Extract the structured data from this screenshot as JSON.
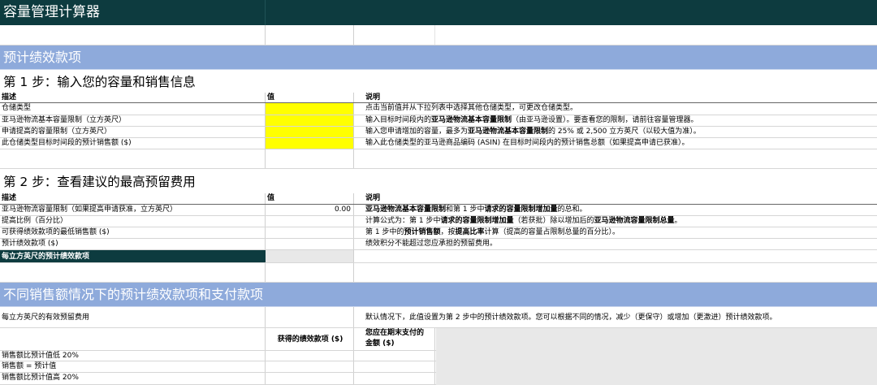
{
  "app": {
    "title": "容量管理计算器"
  },
  "section1": {
    "banner": "预计绩效款项"
  },
  "step1": {
    "title": "第 1 步：输入您的容量和销售信息",
    "headers": {
      "desc": "描述",
      "value": "值",
      "note": "说明"
    },
    "rows": [
      {
        "desc": "仓储类型",
        "value": "",
        "note_parts": [
          {
            "t": "点击当前值并从下拉列表中选择其他仓储类型，可更改仓储类型。",
            "b": false
          }
        ]
      },
      {
        "desc": "亚马逊物流基本容量限制（立方英尺）",
        "value": "",
        "note_parts": [
          {
            "t": "输入目标时间段内的",
            "b": false
          },
          {
            "t": "亚马逊物流基本容量限制",
            "b": true
          },
          {
            "t": "（由亚马逊设置）。要查看您的限制，请前往容量管理器。",
            "b": false
          }
        ]
      },
      {
        "desc": "申请提高的容量限制（立方英尺）",
        "value": "",
        "note_parts": [
          {
            "t": "输入您申请增加的容量，最多为",
            "b": false
          },
          {
            "t": "亚马逊物流基本容量限制",
            "b": true
          },
          {
            "t": "的 25% 或 2,500 立方英尺（以较大值为准）。",
            "b": false
          }
        ]
      },
      {
        "desc": "此仓储类型目标时间段的预计销售额 ($)",
        "value": "",
        "note_parts": [
          {
            "t": "输入此仓储类型的亚马逊商品编码 (ASIN) 在目标时间段内的预计销售总额（如果提高申请已获准）。",
            "b": false
          }
        ]
      }
    ]
  },
  "step2": {
    "title": "第 2 步：查看建议的最高预留费用",
    "headers": {
      "desc": "描述",
      "value": "值",
      "note": "说明"
    },
    "rows": [
      {
        "desc": "亚马逊物流容量限制（如果提高申请获准，立方英尺）",
        "value": "0.00",
        "note_parts": [
          {
            "t": "亚马逊物流基本容量限制",
            "b": true
          },
          {
            "t": "和第 1 步中",
            "b": false
          },
          {
            "t": "请求的容量限制增加量",
            "b": true
          },
          {
            "t": "的总和。",
            "b": false
          }
        ]
      },
      {
        "desc": "提高比例（百分比）",
        "value": "",
        "note_parts": [
          {
            "t": "计算公式为：第 1 步中",
            "b": false
          },
          {
            "t": "请求的容量限制增加量",
            "b": true
          },
          {
            "t": "（若获批）除以增加后的",
            "b": false
          },
          {
            "t": "亚马逊物流容量限制总量",
            "b": true
          },
          {
            "t": "。",
            "b": false
          }
        ]
      },
      {
        "desc": "可获得绩效款项的最低销售额 ($)",
        "value": "",
        "note_parts": [
          {
            "t": "第 1 步中的",
            "b": false
          },
          {
            "t": "预计销售额",
            "b": true
          },
          {
            "t": "，按",
            "b": false
          },
          {
            "t": "提高比率",
            "b": true
          },
          {
            "t": "计算（提高的容量占限制总量的百分比）。",
            "b": false
          }
        ]
      },
      {
        "desc": "预计绩效款项 ($)",
        "value": "",
        "note_parts": [
          {
            "t": "绩效积分不能超过您应承担的预留费用。",
            "b": false
          }
        ]
      }
    ],
    "highlight_row": "每立方英尺的预计绩效款项"
  },
  "section2": {
    "banner": "不同销售额情况下的预计绩效款项和支付款项",
    "effective_row": {
      "desc": "每立方英尺的有效预留费用",
      "note": "默认情况下，此值设置为第 2 步中的预计绩效款项。您可以根据不同的情况，减少（更保守）或增加（更激进）预计绩效款项。"
    },
    "col_headers": {
      "earned": "获得的绩效款项 ($)",
      "due_line1": "您应在期末支付的",
      "due_line2": "金额 ($)"
    },
    "scenarios": [
      "销售额比预计值低 20%",
      "销售额 = 预计值",
      "销售额比预计值高 20%"
    ]
  },
  "colors": {
    "title_bar": "#0d3b3f",
    "banner": "#8eaadb",
    "input": "#ffff00"
  }
}
